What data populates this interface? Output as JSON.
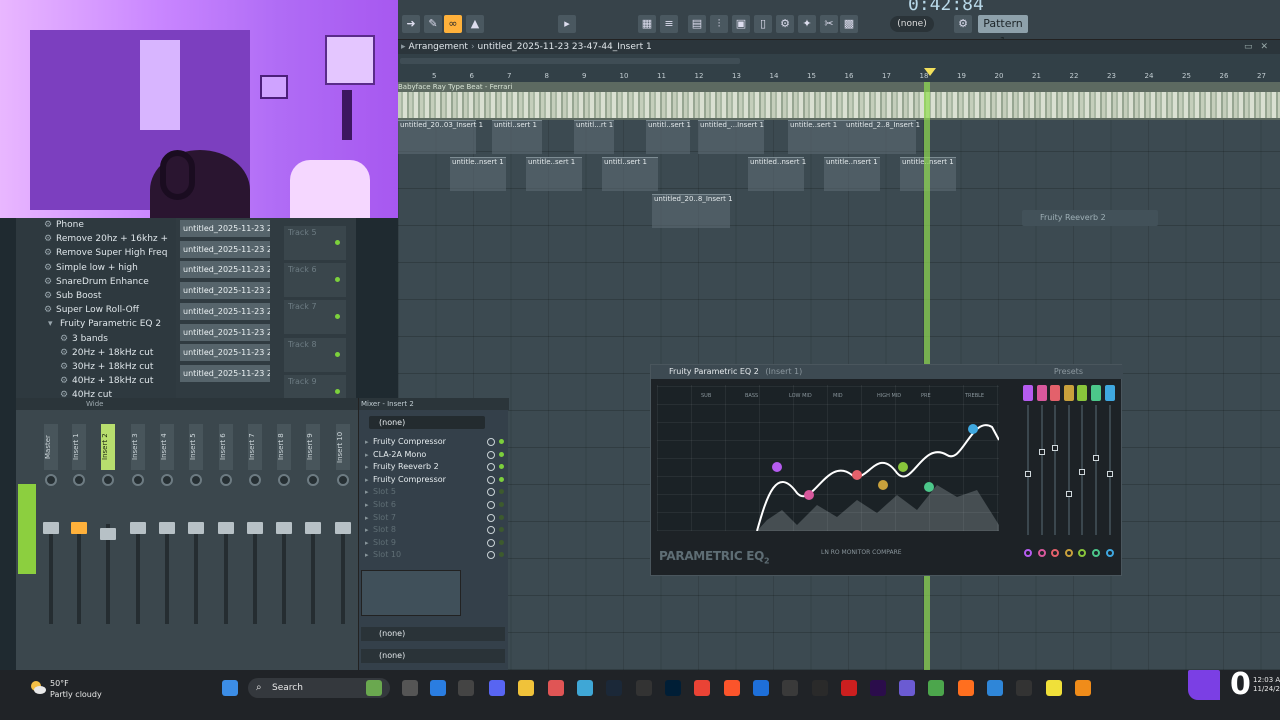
{
  "toolbar": {
    "time_display": "0:42:84",
    "none_select": "(none)",
    "pattern_select": "Pattern 1"
  },
  "arrangement": {
    "title": "Arrangement",
    "project": "untitled_2025-11-23 23-47-44_Insert 1",
    "ruler_numbers": [
      "5",
      "6",
      "7",
      "8",
      "9",
      "10",
      "11",
      "12",
      "13",
      "14",
      "15",
      "16",
      "17",
      "18",
      "19",
      "20",
      "21",
      "22",
      "23",
      "24",
      "25",
      "26",
      "27"
    ],
    "audio_lane_label": "Babyface Ray Type Beat - Ferrari",
    "clips_row1": [
      "untitled_20..03_Insert 1",
      "untitl..sert 1",
      "untitl...rt 1",
      "untitl..sert 1",
      "untitled_...Insert 1",
      "untitle..sert 1",
      "untitled_2..8_Insert 1"
    ],
    "clips_row2": [
      "untitle..nsert 1",
      "untitle..sert 1",
      "untitl..sert 1",
      "untitled..nsert 1",
      "untitle..nsert 1",
      "untitle..nsert 1"
    ],
    "clips_row3": [
      "untitled_20..8_Insert 1"
    ],
    "reverb_float": "Fruity Reeverb 2"
  },
  "browser": {
    "items": [
      "Phone",
      "Remove 20hz + 16khz +",
      "Remove Super High Freq",
      "Simple low + high",
      "SnareDrum Enhance",
      "Sub Boost",
      "Super Low Roll-Off",
      "Fruity Parametric EQ 2",
      "3 bands",
      "20Hz + 18kHz cut",
      "30Hz + 18kHz cut",
      "40Hz + 18kHz cut",
      "40Hz cut"
    ]
  },
  "playlist": {
    "names": [
      "untitled_2025-11-23 23-...",
      "untitled_2025-11-23 23-...",
      "untitled_2025-11-23 23-...",
      "untitled_2025-11-23 23-...",
      "untitled_2025-11-23 23-...",
      "untitled_2025-11-23 23-...",
      "untitled_2025-11-23 23-...",
      "untitled_2025-11-23 23-..."
    ],
    "tracks": [
      "Track 5",
      "Track 6",
      "Track 7",
      "Track 8",
      "Track 9"
    ]
  },
  "mixer": {
    "header": "Wide",
    "strips": [
      "Master",
      "Insert 1",
      "Insert 2",
      "Insert 3",
      "Insert 4",
      "Insert 5",
      "Insert 6",
      "Insert 7",
      "Insert 8",
      "Insert 9",
      "Insert 10"
    ]
  },
  "insert_panel": {
    "title": "Mixer - Insert 2",
    "top_select": "(none)",
    "slots": [
      "Fruity Compressor",
      "CLA-2A Mono",
      "Fruity Reeverb 2",
      "Fruity Compressor",
      "Slot 5",
      "Slot 6",
      "Slot 7",
      "Slot 8",
      "Slot 9",
      "Slot 10"
    ],
    "bottom1": "(none)",
    "bottom2": "(none)"
  },
  "peq": {
    "title": "Fruity Parametric EQ 2",
    "title_suffix": "(Insert 1)",
    "presets": "Presets",
    "bands": [
      "SUB",
      "BASS",
      "LOW MID",
      "MID",
      "HIGH MID",
      "PRE",
      "TREBLE"
    ],
    "logo": "PARAMETRIC EQ",
    "logo_sub": "2",
    "bottom_labels": "LN   RO   MONITOR   COMPARE",
    "band_colors": [
      "#b65cf0",
      "#d7589c",
      "#e3616b",
      "#c9a13c",
      "#89c53b",
      "#4cc78a",
      "#3fa8e0"
    ]
  },
  "taskbar": {
    "weather_temp": "50°F",
    "weather_desc": "Partly cloudy",
    "search": "Search",
    "clock_time": "12:03 AM",
    "clock_date": "11/24/2025",
    "stream_overlay": "0"
  }
}
